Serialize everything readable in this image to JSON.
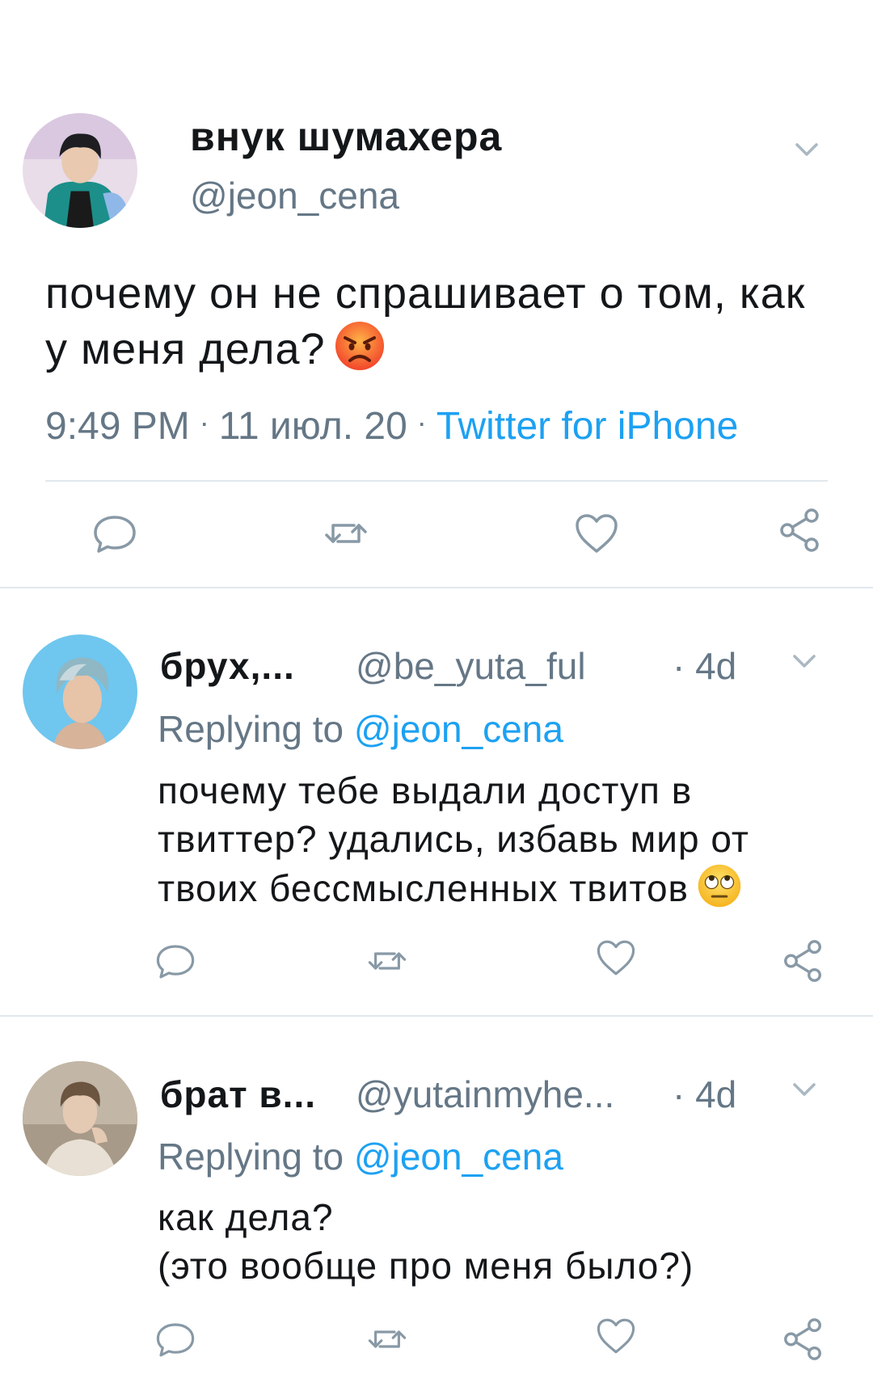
{
  "main_tweet": {
    "display_name": "внук шумахера",
    "handle": "@jeon_cena",
    "text": "почему он не спрашивает о том, как у меня дела?",
    "emoji": "pouting-face-emoji",
    "time": "9:49 PM",
    "date": "11 июл. 20",
    "source": "Twitter for iPhone"
  },
  "replies": [
    {
      "display_name": "брух,...",
      "handle": "@be_yuta_ful",
      "time": "· 4d",
      "replying_prefix": "Replying to ",
      "replying_to": "@jeon_cena",
      "text": "почему тебе выдали доступ в твиттер? удались, избавь мир от твоих бессмысленных твитов",
      "emoji": "eye-roll-emoji"
    },
    {
      "display_name": "брат в...",
      "handle": "@yutainmyhe...",
      "time": "· 4d",
      "replying_prefix": "Replying to ",
      "replying_to": "@jeon_cena",
      "text": "как дела?\n(это вообще про меня было?)"
    }
  ],
  "colors": {
    "accent": "#1da1f2",
    "muted": "#657786",
    "text": "#14171a",
    "divider": "#e1e8ed",
    "icon": "#657786"
  },
  "icons": [
    "reply-icon",
    "retweet-icon",
    "like-icon",
    "share-icon",
    "chevron-down-icon"
  ]
}
